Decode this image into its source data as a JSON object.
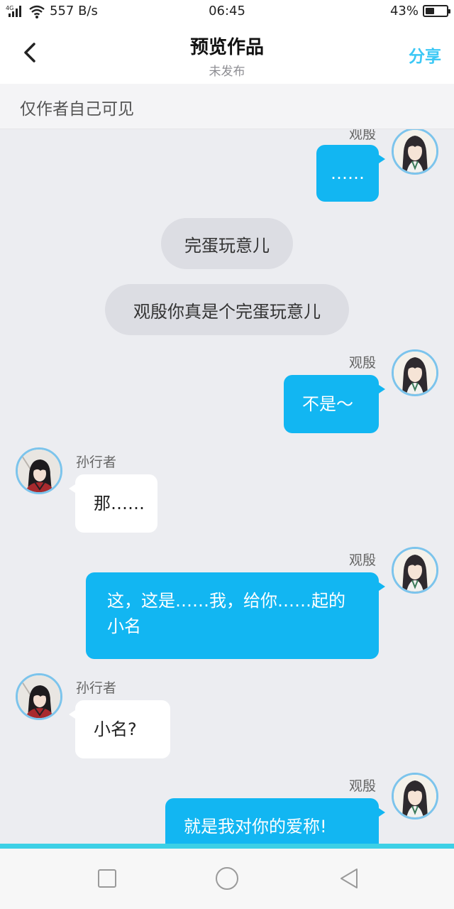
{
  "status_bar": {
    "network": "4G",
    "speed": "557 B/s",
    "time": "06:45",
    "battery_percent": "43%",
    "battery_level": 0.43
  },
  "header": {
    "title": "预览作品",
    "subtitle": "未发布",
    "share_label": "分享"
  },
  "notice": "仅作者自己可见",
  "messages": [
    {
      "type": "right",
      "name": "观殷",
      "text": "……"
    },
    {
      "type": "narration",
      "text": "完蛋玩意儿"
    },
    {
      "type": "narration",
      "text": "观殷你真是个完蛋玩意儿"
    },
    {
      "type": "right",
      "name": "观殷",
      "text": "不是～"
    },
    {
      "type": "left",
      "name": "孙行者",
      "text": "那……"
    },
    {
      "type": "right",
      "name": "观殷",
      "text_line1": "这，这是……我，给你……起的",
      "text_line2": "小名"
    },
    {
      "type": "left",
      "name": "孙行者",
      "text": "小名?"
    },
    {
      "type": "right",
      "name": "观殷",
      "text": "就是我对你的爱称!"
    }
  ],
  "colors": {
    "accent": "#3CC8F5",
    "bubble_right": "#12B6F2",
    "bubble_left": "#FFFFFF",
    "chat_bg": "#ECEDF1"
  },
  "nav": {
    "icons": [
      "square-icon",
      "circle-icon",
      "triangle-back-icon"
    ]
  }
}
